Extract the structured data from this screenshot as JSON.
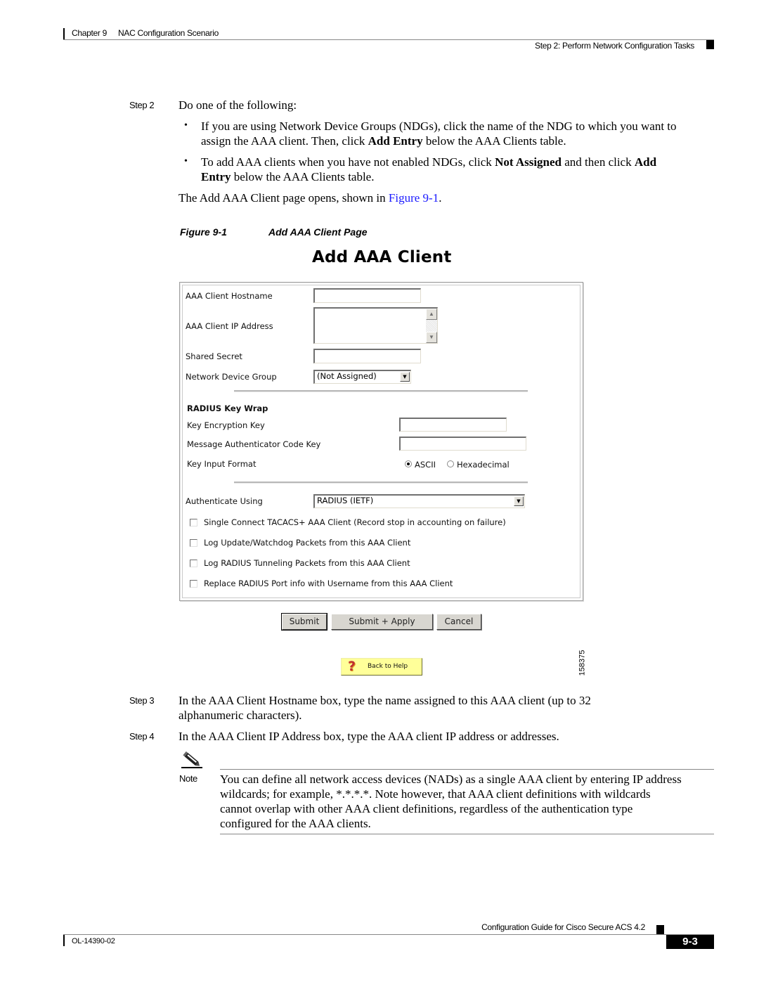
{
  "header": {
    "chapter_number": "Chapter 9",
    "chapter_title": "NAC Configuration Scenario",
    "section": "Step 2: Perform Network Configuration Tasks"
  },
  "step2": {
    "label": "Step 2",
    "intro": "Do one of the following:",
    "bullets": [
      {
        "line1": "If you are using Network Device Groups (NDGs), click the name of the NDG to which you want to",
        "line2_pre": "assign the AAA client. Then, click ",
        "line2_bold": "Add Entry",
        "line2_post": " below the AAA Clients table."
      },
      {
        "line1_pre": "To add AAA clients when you have not enabled NDGs, click ",
        "line1_bold1": "Not Assigned",
        "line1_mid": " and then click ",
        "line1_bold2": "Add",
        "line2_bold": "Entry",
        "line2_post": " below the AAA Clients table."
      }
    ],
    "followup_pre": "The Add AAA Client page opens, shown in ",
    "followup_link": "Figure 9-1",
    "followup_post": "."
  },
  "figure": {
    "number": "Figure 9-1",
    "caption": "Add AAA Client Page",
    "id": "158375",
    "screen": {
      "title": "Add AAA Client",
      "fields": {
        "hostname_label": "AAA Client Hostname",
        "hostname_value": "",
        "ip_label": "AAA Client IP Address",
        "ip_value": "",
        "secret_label": "Shared Secret",
        "secret_value": "",
        "ndg_label": "Network Device Group",
        "ndg_value": "(Not Assigned)"
      },
      "key_wrap": {
        "heading": "RADIUS Key Wrap",
        "kek_label": "Key Encryption Key",
        "kek_value": "",
        "mack_label": "Message Authenticator Code Key",
        "mack_value": "",
        "format_label": "Key Input Format",
        "format_options": [
          "ASCII",
          "Hexadecimal"
        ],
        "format_selected": "ASCII"
      },
      "auth_label": "Authenticate Using",
      "auth_value": "RADIUS (IETF)",
      "checkboxes": [
        {
          "label": "Single Connect TACACS+ AAA Client (Record stop in accounting on failure)",
          "checked": false
        },
        {
          "label": "Log Update/Watchdog Packets from this AAA Client",
          "checked": false
        },
        {
          "label": "Log RADIUS Tunneling Packets from this AAA Client",
          "checked": false
        },
        {
          "label": "Replace RADIUS Port info with Username from this AAA Client",
          "checked": false
        }
      ],
      "buttons": {
        "submit": "Submit",
        "submit_apply": "Submit + Apply",
        "cancel": "Cancel",
        "back_to_help": "Back to Help"
      },
      "icons": {
        "help": "question-mark-icon",
        "scroll_up": "scroll-up-arrow-icon",
        "scroll_down": "scroll-down-arrow-icon",
        "dropdown": "dropdown-arrow-icon"
      }
    }
  },
  "step3": {
    "label": "Step 3",
    "line1": "In the AAA Client Hostname box, type the name assigned to this AAA client (up to 32",
    "line2": "alphanumeric characters)."
  },
  "step4": {
    "label": "Step 4",
    "text": "In the AAA Client IP Address box, type the AAA client IP address or addresses."
  },
  "note": {
    "icon": "pencil-note-icon",
    "label": "Note",
    "lines": [
      "You can define all network access devices (NADs) as a single AAA client by entering IP address",
      "wildcards; for example, *.*.*.*. Note however, that AAA client definitions with wildcards",
      "cannot overlap with other AAA client definitions, regardless of the authentication type",
      "configured for the AAA clients."
    ]
  },
  "footer": {
    "guide_title": "Configuration Guide for Cisco Secure ACS 4.2",
    "doc_number": "OL-14390-02",
    "page_number": "9-3"
  },
  "colors": {
    "link": "#1a1aff",
    "help_button": "#ffff99",
    "button_face": "#d8d6d0"
  }
}
